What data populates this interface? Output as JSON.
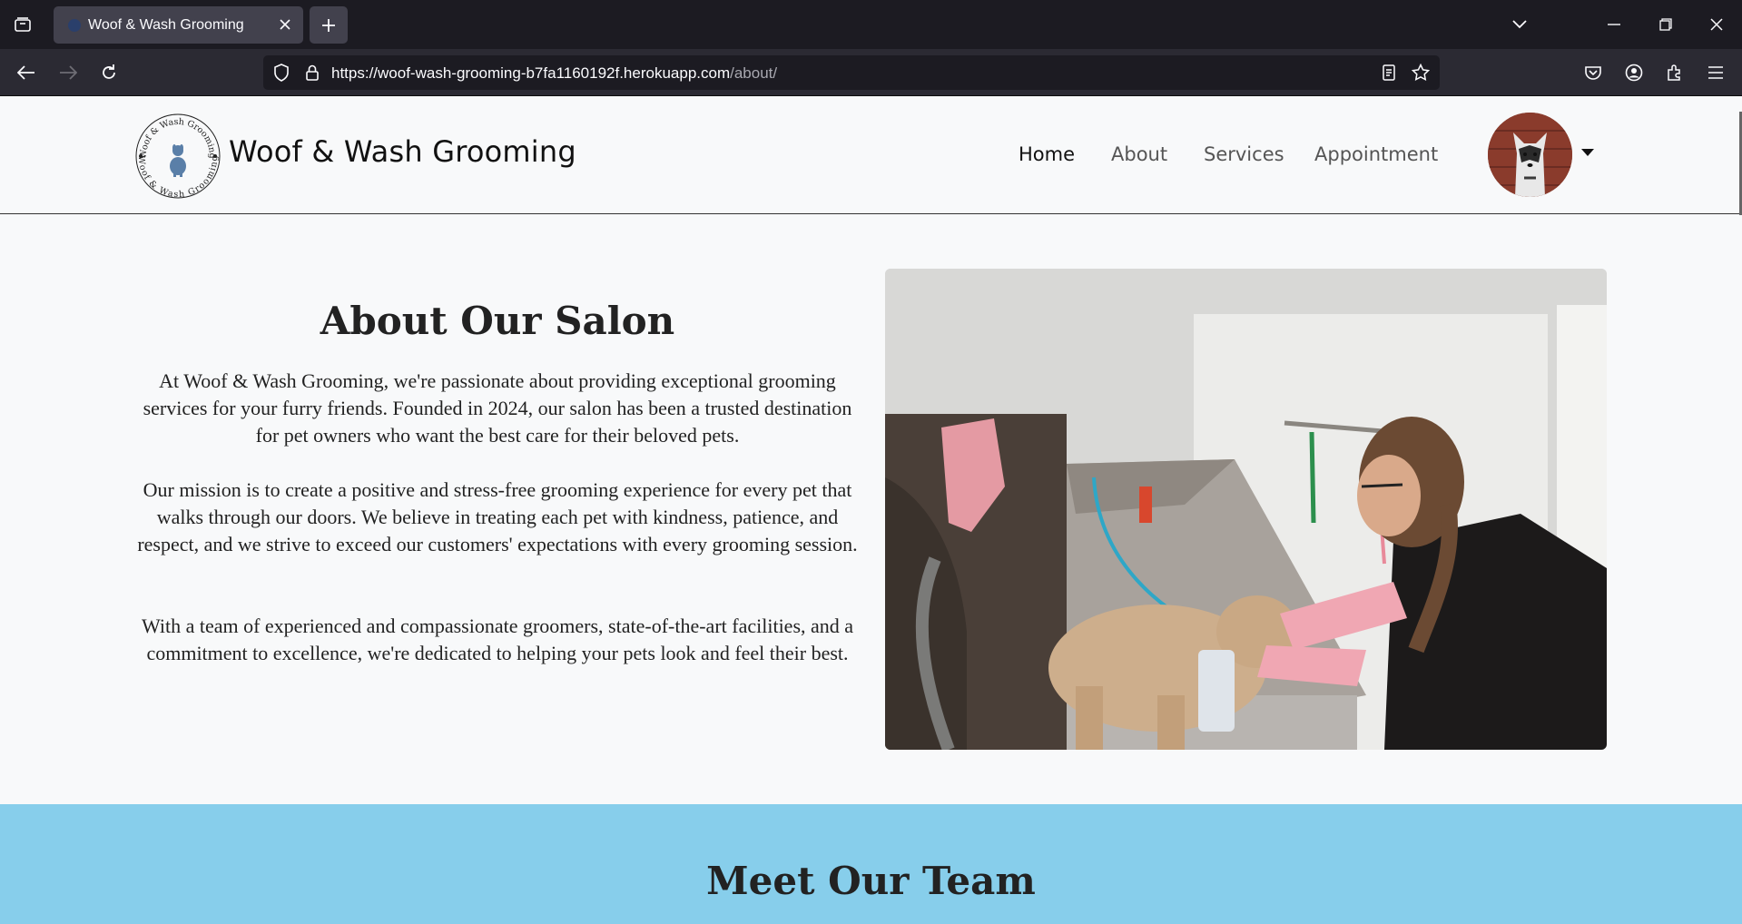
{
  "browser": {
    "tab_title": "Woof & Wash Grooming",
    "url_host": "https://woof-wash-grooming-b7fa1160192f.herokuapp.com",
    "url_path": "/about/"
  },
  "site": {
    "brand": "Woof & Wash Grooming",
    "logo_text_top": "Woof & Wash Grooming",
    "logo_text_bottom": "Woof & Wash Grooming",
    "nav": [
      {
        "label": "Home"
      },
      {
        "label": "About"
      },
      {
        "label": "Services"
      },
      {
        "label": "Appointment"
      }
    ]
  },
  "about": {
    "title": "About Our Salon",
    "p1": "At Woof & Wash Grooming, we're passionate about providing exceptional grooming services for your furry friends. Founded in 2024, our salon has been a trusted destination for pet owners who want the best care for their beloved pets.",
    "p2": "Our mission is to create a positive and stress-free grooming experience for every pet that walks through our doors. We believe in treating each pet with kindness, patience, and respect, and we strive to exceed our customers' expectations with every grooming session.",
    "p3": "With a team of experienced and compassionate groomers, state-of-the-art facilities, and a commitment to excellence, we're dedicated to helping your pets look and feel their best."
  },
  "team": {
    "title": "Meet Our Team"
  },
  "colors": {
    "team_bg": "#87ceeb",
    "page_bg": "#f8f9fa",
    "chrome_bg": "#1c1b22"
  }
}
